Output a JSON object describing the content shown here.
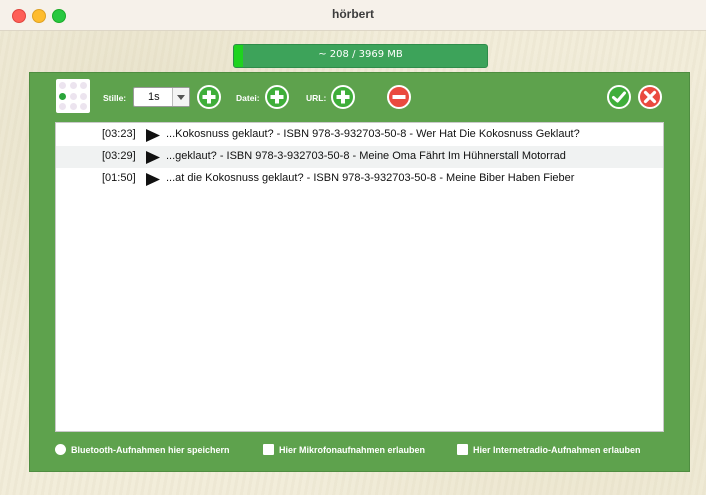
{
  "window": {
    "title": "hörbert"
  },
  "storage": {
    "label": "~ 208 / 3969 MB",
    "used_mb": 208,
    "total_mb": 3969
  },
  "toolbar": {
    "silence_label": "Stille:",
    "silence_value": "1s",
    "file_label": "Datei:",
    "url_label": "URL:"
  },
  "tracks": [
    {
      "duration": "[03:23]",
      "title": "...Kokosnuss geklaut? - ISBN 978-3-932703-50-8 - Wer Hat Die Kokosnuss Geklaut?"
    },
    {
      "duration": "[03:29]",
      "title": "...geklaut? - ISBN 978-3-932703-50-8 - Meine Oma Fährt Im Hühnerstall Motorrad"
    },
    {
      "duration": "[01:50]",
      "title": "...at die Kokosnuss geklaut? - ISBN 978-3-932703-50-8 - Meine Biber Haben Fieber"
    }
  ],
  "options": {
    "bluetooth": "Bluetooth-Aufnahmen hier speichern",
    "microphone": "Hier Mikrofonaufnahmen erlauben",
    "internetradio": "Hier Internetradio-Aufnahmen erlauben"
  },
  "icons": {
    "add": "plus-icon",
    "remove": "minus-icon",
    "confirm": "checkmark-icon",
    "cancel": "x-icon",
    "play": "play-icon",
    "playlist_selector": "dot-grid-icon"
  },
  "colors": {
    "panel": "#5ea24d",
    "add_button": "#3fae3a",
    "remove_button": "#ea4a3f",
    "storage_bar": "#3da35a",
    "storage_fill": "#1fd31f"
  }
}
